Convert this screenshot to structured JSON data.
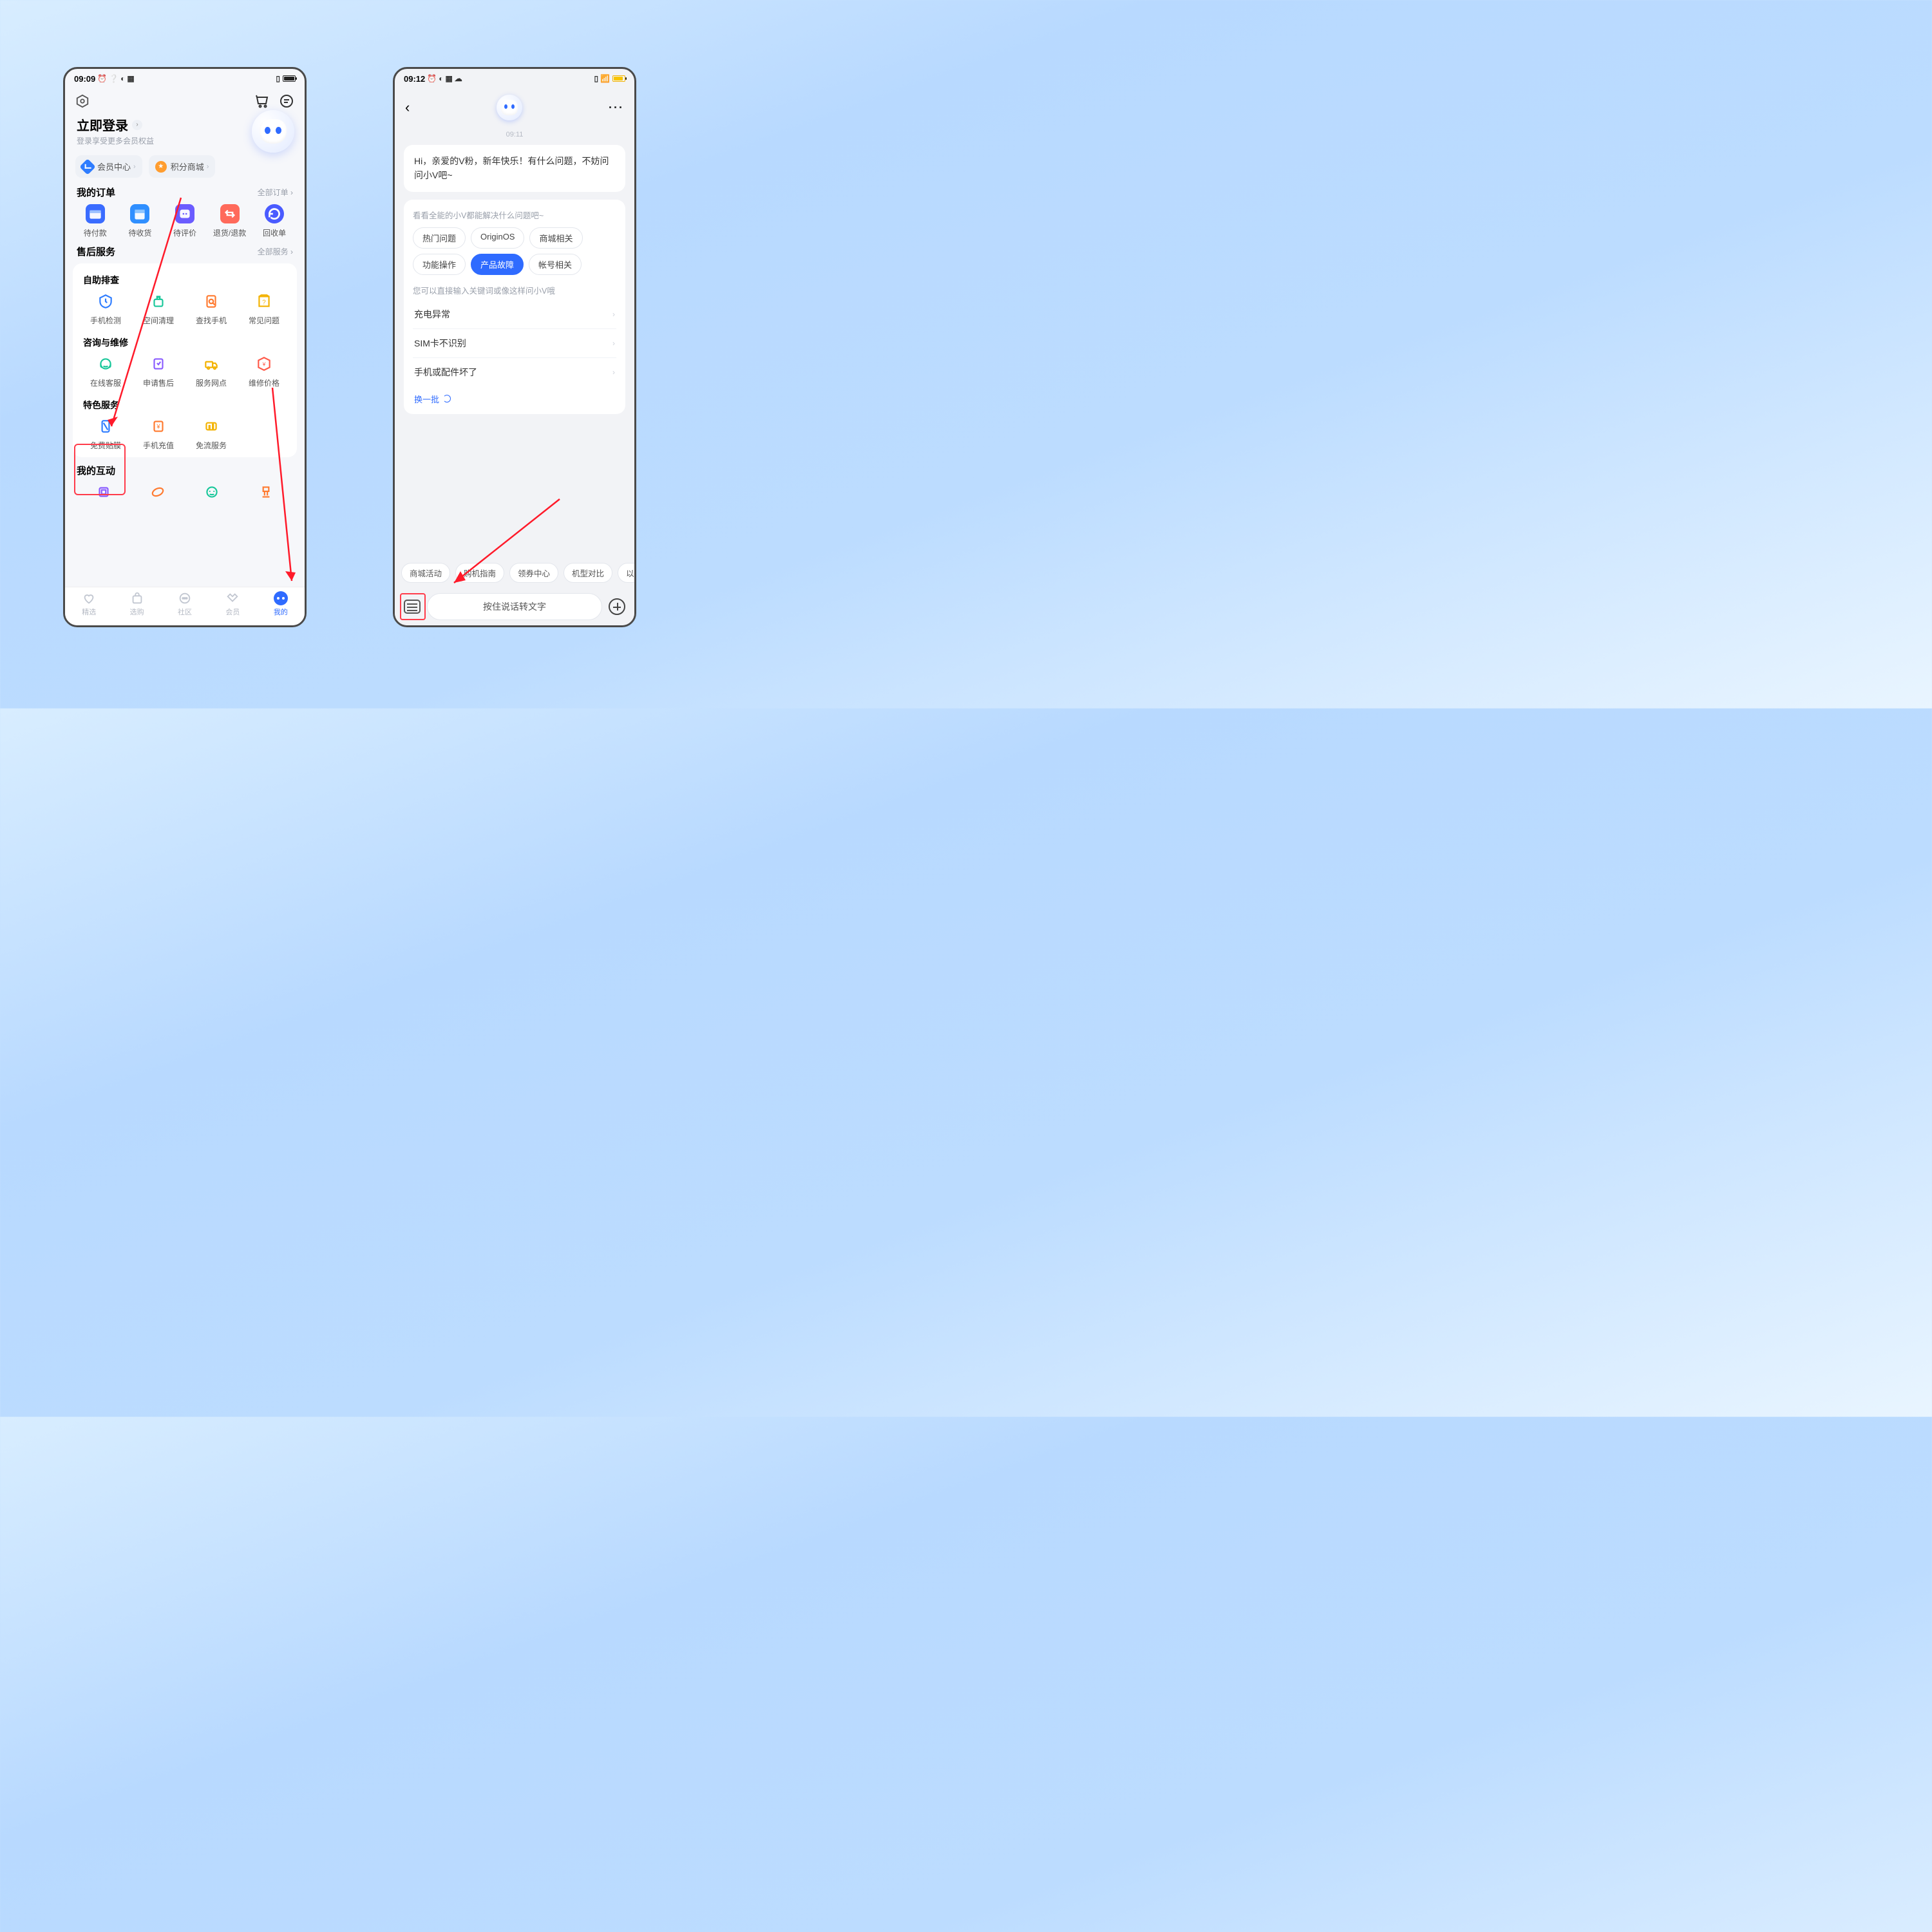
{
  "left": {
    "status_time": "09:09",
    "login_title": "立即登录",
    "login_sub": "登录享受更多会员权益",
    "pill_member": "会员中心",
    "pill_points": "积分商城",
    "orders_title": "我的订单",
    "orders_more": "全部订单",
    "orders_items": [
      "待付款",
      "待收货",
      "待评价",
      "退货/退款",
      "回收单"
    ],
    "service_title": "售后服务",
    "service_more": "全部服务",
    "svc_group1_title": "自助排查",
    "svc_group1": [
      "手机检测",
      "空间清理",
      "查找手机",
      "常见问题"
    ],
    "svc_group2_title": "咨询与维修",
    "svc_group2": [
      "在线客服",
      "申请售后",
      "服务网点",
      "维修价格"
    ],
    "svc_group3_title": "特色服务",
    "svc_group3": [
      "免费贴膜",
      "手机充值",
      "免流服务"
    ],
    "interact_title": "我的互动",
    "nav": [
      "精选",
      "选购",
      "社区",
      "会员",
      "我的"
    ]
  },
  "right": {
    "status_time": "09:12",
    "chat_time": "09:11",
    "greeting": "Hi，亲爱的V粉，新年快乐！有什么问题，不妨问问小V吧~",
    "card_hint": "看看全能的小V都能解决什么问题吧~",
    "topics": [
      "热门问题",
      "OriginOS",
      "商城相关",
      "功能操作",
      "产品故障",
      "帐号相关"
    ],
    "topic_selected_index": 4,
    "card_hint2": "您可以直接输入关键词或像这样问小V哦",
    "questions": [
      "充电异常",
      "SIM卡不识别",
      "手机或配件坏了"
    ],
    "swap_label": "换一批",
    "bottom_chips": [
      "商城活动",
      "购机指南",
      "领券中心",
      "机型对比",
      "以"
    ],
    "talk_placeholder": "按住说话转文字"
  }
}
